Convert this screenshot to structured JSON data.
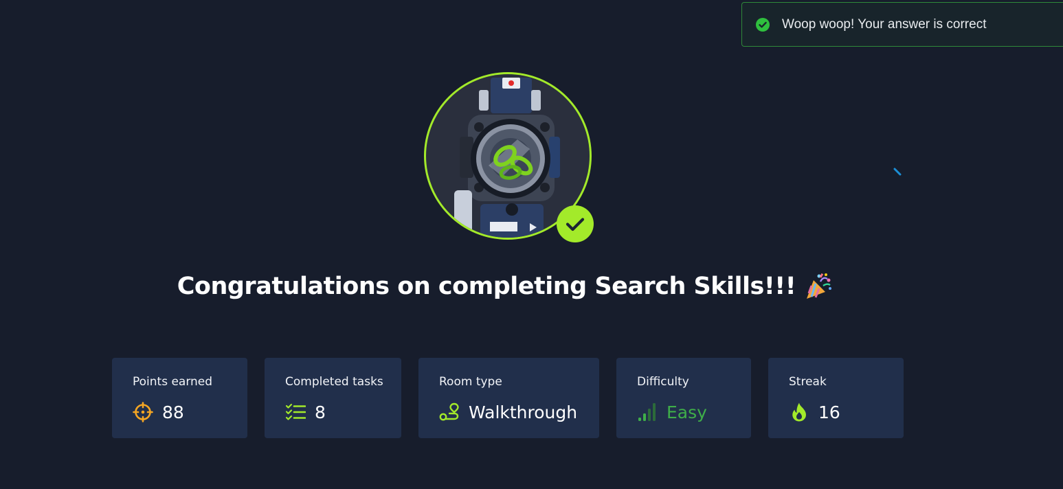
{
  "toast": {
    "message": "Woop woop! Your answer is correct",
    "icon": "check-circle-icon",
    "color": "#2fbf3e"
  },
  "room_badge": {
    "icon": "scope-icon",
    "ring_color": "#a3ea2a",
    "completed_icon": "checkmark-icon"
  },
  "heading": {
    "title": "Congratulations on completing Search Skills!!!",
    "emoji_icon": "party-popper-icon"
  },
  "stats": [
    {
      "label": "Points earned",
      "value": "88",
      "icon": "crosshair-icon",
      "icon_color": "#f5a623"
    },
    {
      "label": "Completed tasks",
      "value": "8",
      "icon": "checklist-icon",
      "icon_color": "#a3ea2a"
    },
    {
      "label": "Room type",
      "value": "Walkthrough",
      "icon": "route-icon",
      "icon_color": "#a3ea2a"
    },
    {
      "label": "Difficulty",
      "value": "Easy",
      "icon": "signal-bars-icon",
      "icon_color": "#3fae49"
    },
    {
      "label": "Streak",
      "value": "16",
      "icon": "flame-icon",
      "icon_color": "#a3ea2a"
    }
  ],
  "colors": {
    "background": "#171d2c",
    "card": "#212f4b",
    "accent": "#a3ea2a",
    "easy": "#3fae49"
  }
}
